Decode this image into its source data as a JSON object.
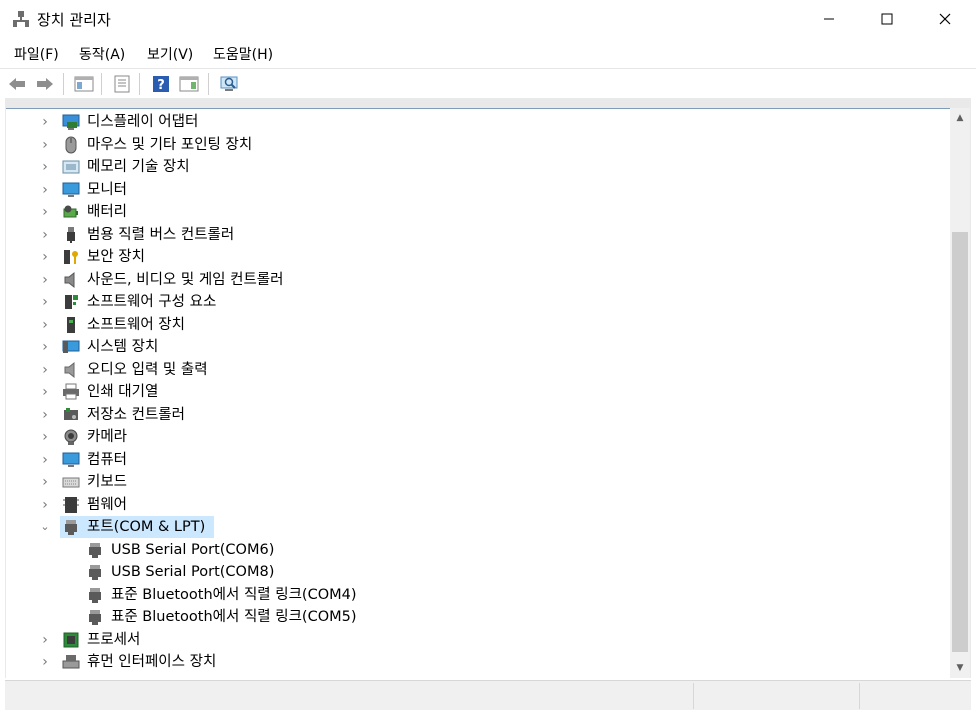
{
  "window": {
    "title": "장치 관리자"
  },
  "menu": {
    "file": "파일(F)",
    "action": "동작(A)",
    "view": "보기(V)",
    "help": "도움말(H)"
  },
  "tree": {
    "items": [
      {
        "label": "디스플레이 어댑터",
        "icon": "display-adapter-icon"
      },
      {
        "label": "마우스 및 기타 포인팅 장치",
        "icon": "mouse-icon"
      },
      {
        "label": "메모리 기술 장치",
        "icon": "memory-device-icon"
      },
      {
        "label": "모니터",
        "icon": "monitor-icon"
      },
      {
        "label": "배터리",
        "icon": "battery-icon"
      },
      {
        "label": "범용 직렬 버스 컨트롤러",
        "icon": "usb-controller-icon"
      },
      {
        "label": "보안 장치",
        "icon": "security-device-icon"
      },
      {
        "label": "사운드, 비디오 및 게임 컨트롤러",
        "icon": "speaker-icon"
      },
      {
        "label": "소프트웨어 구성 요소",
        "icon": "software-component-icon"
      },
      {
        "label": "소프트웨어 장치",
        "icon": "software-device-icon"
      },
      {
        "label": "시스템 장치",
        "icon": "system-device-icon"
      },
      {
        "label": "오디오 입력 및 출력",
        "icon": "audio-io-icon"
      },
      {
        "label": "인쇄 대기열",
        "icon": "printer-icon"
      },
      {
        "label": "저장소 컨트롤러",
        "icon": "storage-controller-icon"
      },
      {
        "label": "카메라",
        "icon": "camera-icon"
      },
      {
        "label": "컴퓨터",
        "icon": "computer-icon"
      },
      {
        "label": "키보드",
        "icon": "keyboard-icon"
      },
      {
        "label": "펌웨어",
        "icon": "firmware-icon"
      },
      {
        "label": "포트(COM & LPT)",
        "icon": "port-icon",
        "expanded": true,
        "selected": true
      },
      {
        "label": "USB Serial Port(COM6)",
        "icon": "port-icon",
        "child": true
      },
      {
        "label": "USB Serial Port(COM8)",
        "icon": "port-icon",
        "child": true
      },
      {
        "label": "표준 Bluetooth에서 직렬 링크(COM4)",
        "icon": "port-icon",
        "child": true
      },
      {
        "label": "표준 Bluetooth에서 직렬 링크(COM5)",
        "icon": "port-icon",
        "child": true
      },
      {
        "label": "프로세서",
        "icon": "processor-icon"
      },
      {
        "label": "휴먼 인터페이스 장치",
        "icon": "hid-icon"
      }
    ]
  },
  "colors": {
    "selection": "#cce8ff",
    "accent": "#0078d7"
  }
}
